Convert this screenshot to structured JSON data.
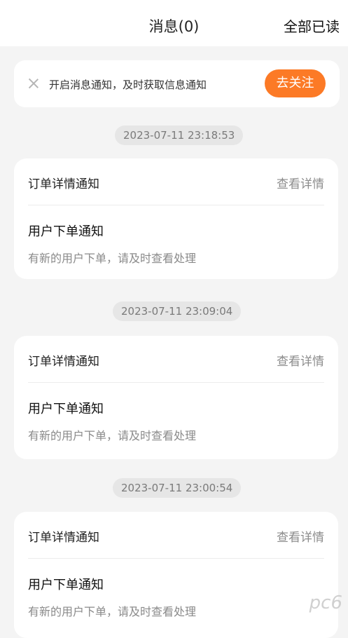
{
  "header": {
    "title": "消息(0)",
    "read_all_label": "全部已读"
  },
  "notify_bar": {
    "close_icon": "close-icon",
    "text": "开启消息通知，及时获取信息通知",
    "follow_label": "去关注",
    "accent_color": "#fc7a26"
  },
  "messages": [
    {
      "timestamp": "2023-07-11 23:18:53",
      "card_title": "订单详情通知",
      "detail_label": "查看详情",
      "msg_title": "用户下单通知",
      "msg_body": "有新的用户下单，请及时查看处理"
    },
    {
      "timestamp": "2023-07-11 23:09:04",
      "card_title": "订单详情通知",
      "detail_label": "查看详情",
      "msg_title": "用户下单通知",
      "msg_body": "有新的用户下单，请及时查看处理"
    },
    {
      "timestamp": "2023-07-11 23:00:54",
      "card_title": "订单详情通知",
      "detail_label": "查看详情",
      "msg_title": "用户下单通知",
      "msg_body": "有新的用户下单，请及时查看处理"
    }
  ],
  "watermark": "pc6"
}
